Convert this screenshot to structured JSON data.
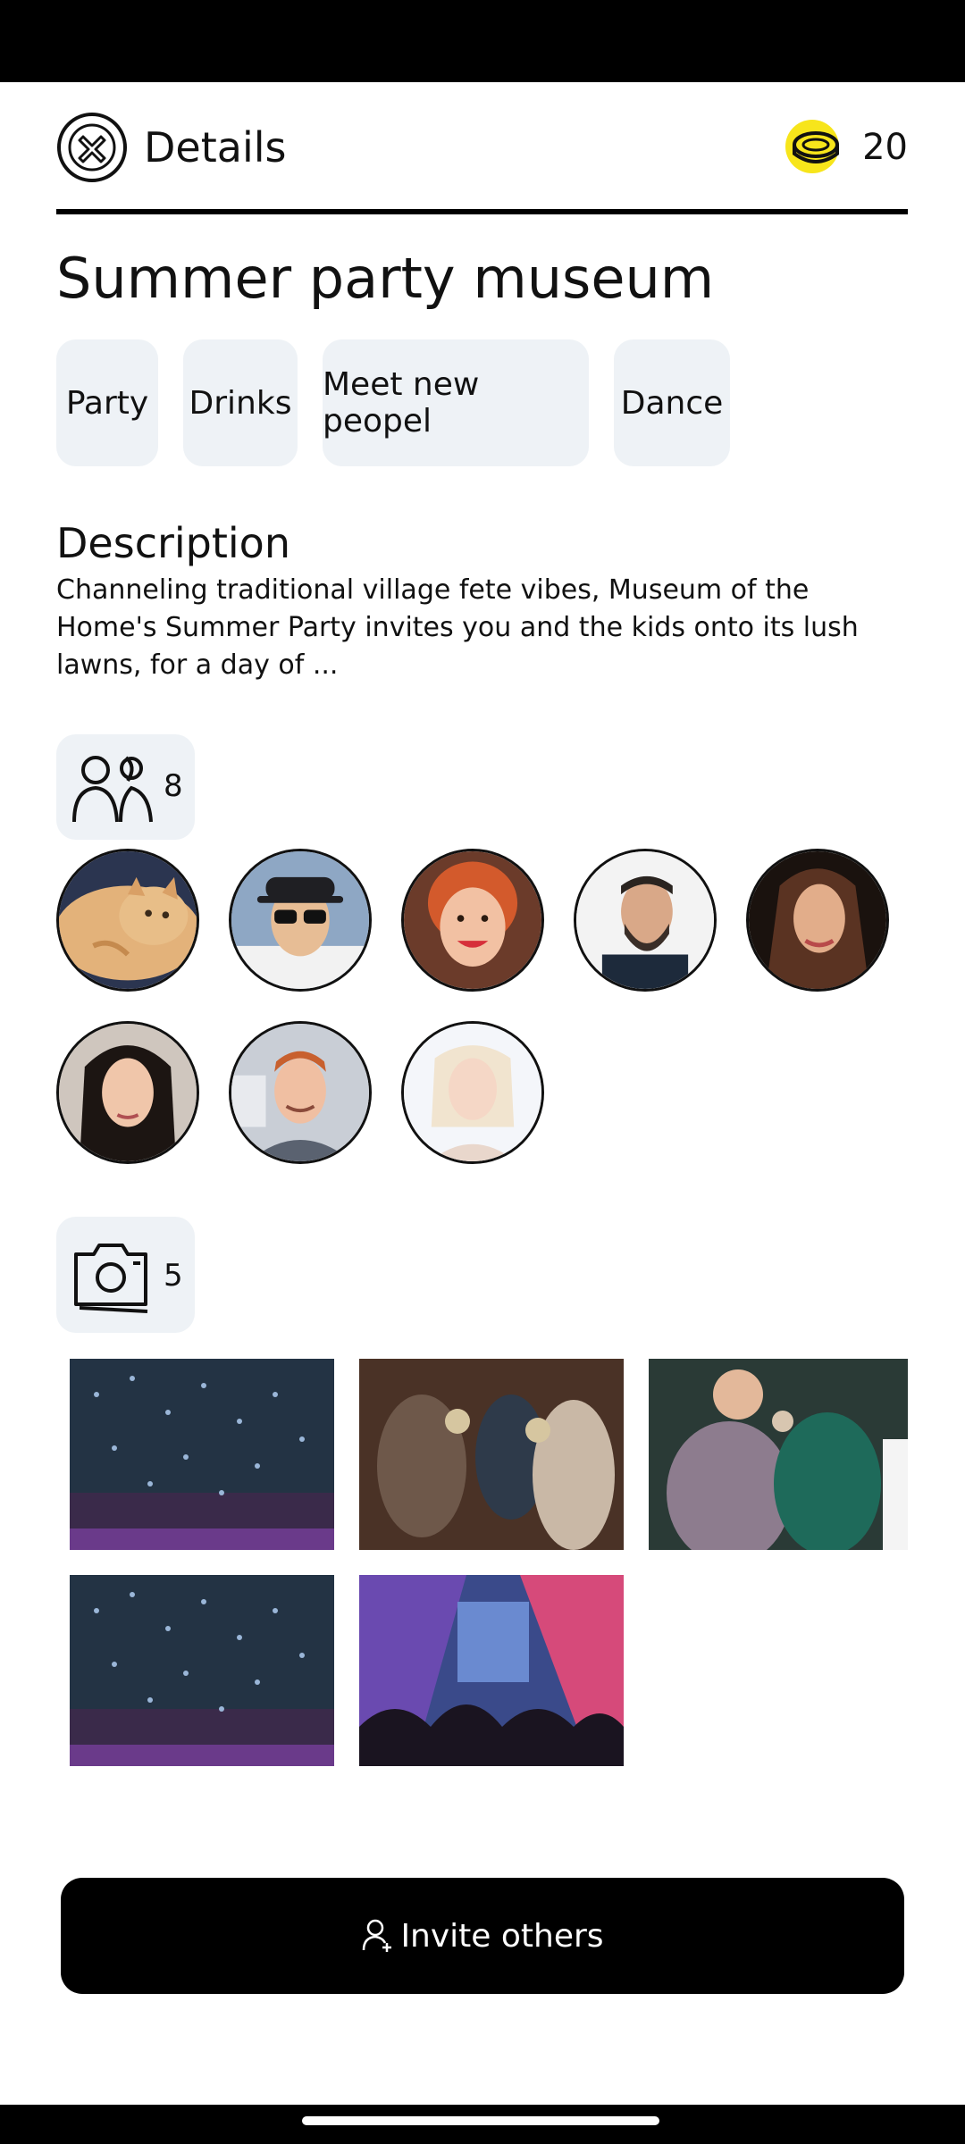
{
  "header": {
    "title": "Details",
    "coins": "20"
  },
  "event": {
    "title": "Summer party museum"
  },
  "tags": [
    "Party",
    "Drinks",
    "Meet new peopel",
    "Dance"
  ],
  "description": {
    "heading": "Description",
    "text": "Channeling traditional village fete vibes, Museum of the Home's Summer Party invites you and the kids onto its lush lawns, for a day of ..."
  },
  "attendees": {
    "count": "8",
    "avatars": [
      "cat",
      "man-cap-sunglasses",
      "red-hair-woman",
      "bearded-man",
      "long-hair-woman",
      "dark-hair-woman",
      "ginger-man",
      "blonde-woman"
    ]
  },
  "photos": {
    "count": "5",
    "items": [
      "confetti-crowd",
      "friends-toasting",
      "men-cheers",
      "confetti-crowd",
      "concert-stage"
    ]
  },
  "invite": {
    "label": "Invite others"
  },
  "icons": {
    "close": "close-icon",
    "coin": "coin-icon",
    "people": "people-icon",
    "camera": "camera-icon",
    "invite": "add-person-icon"
  },
  "colors": {
    "accent": "#000000",
    "chip_bg": "#eef2f6",
    "coin": "#f7e51b"
  }
}
